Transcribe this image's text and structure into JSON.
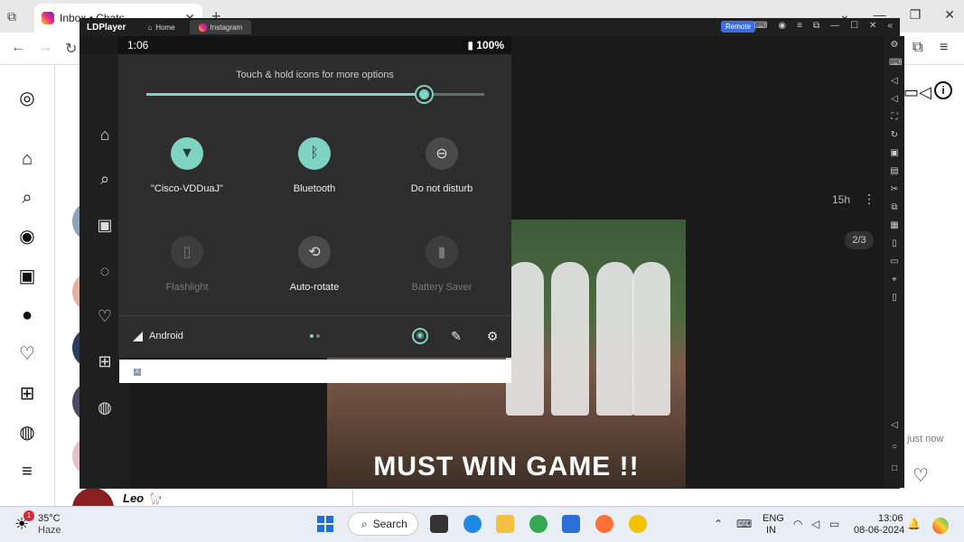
{
  "browser": {
    "tab_title": "Inbox • Chats",
    "tab_close": "✕",
    "new_tab": "+",
    "controls": [
      "⌄",
      "—",
      "❐",
      "✕"
    ]
  },
  "instagram": {
    "chat_name": "Leo 🦙",
    "post_time": "15h",
    "image_counter": "2/3",
    "photo_caption": "MUST WIN GAME !!",
    "last_seen": "just now"
  },
  "ldplayer": {
    "app_name": "LDPlayer",
    "tabs": [
      {
        "label": "Home"
      },
      {
        "label": "Instagram"
      }
    ],
    "remote_label": "Remote"
  },
  "android": {
    "status_time": "1:06",
    "battery": "100%",
    "quick_settings": {
      "hint": "Touch & hold icons for more options",
      "brightness_level": 0.82,
      "tiles": [
        {
          "label": "\"Cisco-VDDuaJ\"",
          "state": "on",
          "icon": "wifi-icon"
        },
        {
          "label": "Bluetooth",
          "state": "on",
          "icon": "bluetooth-icon"
        },
        {
          "label": "Do not disturb",
          "state": "off",
          "icon": "dnd-icon"
        },
        {
          "label": "Flashlight",
          "state": "unavailable",
          "icon": "flashlight-icon"
        },
        {
          "label": "Auto-rotate",
          "state": "off",
          "icon": "rotate-icon"
        },
        {
          "label": "Battery Saver",
          "state": "unavailable",
          "icon": "battery-saver-icon"
        }
      ],
      "network_name": "Android",
      "page_indicator": {
        "current": 1,
        "total": 2
      }
    }
  },
  "taskbar": {
    "weather_temp": "35°C",
    "weather_desc": "Haze",
    "weather_badge": "1",
    "search_label": "Search",
    "lang_line1": "ENG",
    "lang_line2": "IN",
    "time": "13:06",
    "date": "08-06-2024"
  }
}
